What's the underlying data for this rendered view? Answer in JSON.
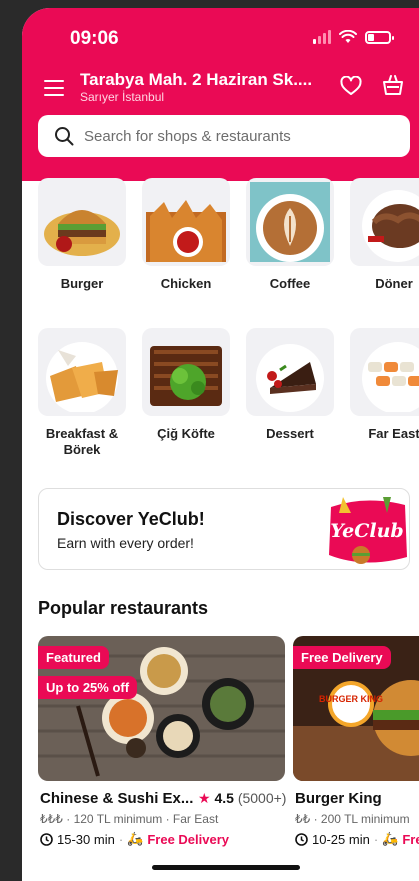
{
  "status": {
    "time": "09:06"
  },
  "header": {
    "address_title": "Tarabya Mah. 2 Haziran Sk....",
    "address_sub": "Sarıyer İstanbul"
  },
  "search": {
    "placeholder": "Search for shops & restaurants"
  },
  "categories": [
    {
      "label": "Burger"
    },
    {
      "label": "Chicken"
    },
    {
      "label": "Coffee"
    },
    {
      "label": "Döner"
    },
    {
      "label": "Breakfast & Börek"
    },
    {
      "label": "Çiğ Köfte"
    },
    {
      "label": "Dessert"
    },
    {
      "label": "Far East"
    }
  ],
  "yeclub": {
    "title": "Discover YeClub!",
    "subtitle": "Earn with every order!",
    "logo_text": "YeClub"
  },
  "popular": {
    "title": "Popular restaurants",
    "restaurants": [
      {
        "badges": [
          "Featured",
          "Up to 25% off"
        ],
        "name": "Chinese & Sushi Ex...",
        "rating": "4.5",
        "rating_count": "(5000+)",
        "meta": "₺₺₺ · 120 TL minimum · Far East",
        "eta": "15-30 min",
        "delivery": "Free Delivery"
      },
      {
        "badges": [
          "Free Delivery"
        ],
        "logo_text": "BURGER KING",
        "name": "Burger King",
        "meta": "₺₺ · 200 TL minimum",
        "eta": "10-25 min",
        "delivery": "Free Delivery"
      }
    ]
  },
  "colors": {
    "brand": "#ea0a55",
    "tile_bg": "#f1f1f4"
  }
}
